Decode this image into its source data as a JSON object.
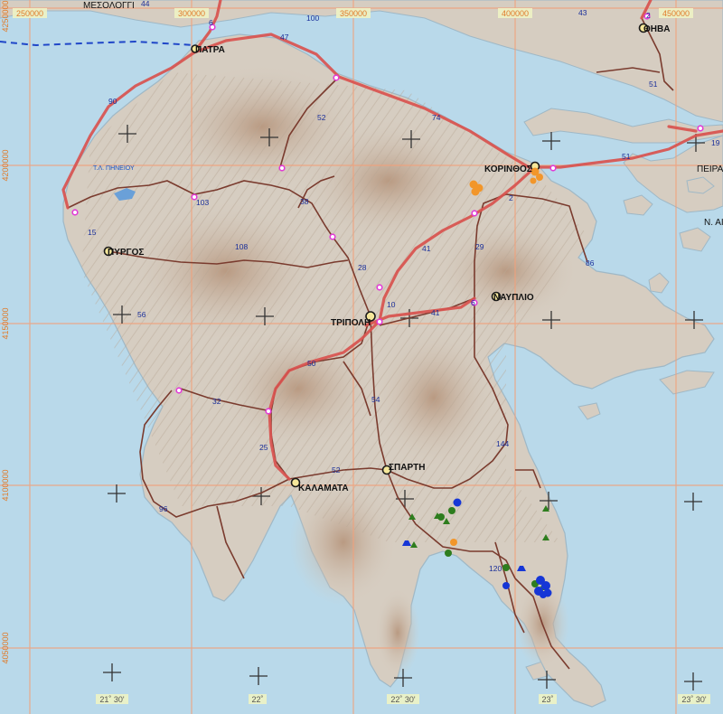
{
  "colors": {
    "sea": "#b9d9ea",
    "land": "#d6cdc1",
    "relief": "#c9b7a4",
    "grid": "#f2a07a",
    "main_road": "#d9534f",
    "local_road": "#7a3b2e",
    "coord_text": "#e07b2a",
    "route_number": "#1a2f9a",
    "city_fill": "#f5e79a",
    "ferry_line": "#1f46c8",
    "lake": "#6aa0d8",
    "marker_green": "#2e7d1e",
    "marker_blue": "#1636d6",
    "marker_orange": "#f2962a",
    "junction": "#e23bd6"
  },
  "top_axis": [
    "250000",
    "300000",
    "350000",
    "400000",
    "450000"
  ],
  "left_axis": [
    "4250000",
    "4200000",
    "4150000",
    "4100000",
    "4050000"
  ],
  "bottom_axis": [
    "21˚ 30'",
    "22˚",
    "22˚ 30'",
    "23˚",
    "23˚ 30'"
  ],
  "cities": [
    "ΠΑΤΡΑ",
    "ΚΟΡΙΝΘΟΣ",
    "ΠΥΡΓΟΣ",
    "ΤΡΙΠΟΛΗ",
    "ΝΑΥΠΛΙΟ",
    "ΣΠΑΡΤΗ",
    "ΚΑΛΑΜΑΤΑ",
    "ΘΗΒΑ"
  ],
  "other_places": [
    "ΜΕΣΟΛΟΓΓΙ",
    "ΠΕΙΡΑ",
    "Ν. ΑΙ"
  ],
  "lake_name": "Τ.Λ. ΠΗΝΕΙΟΥ",
  "route_numbers": [
    "44",
    "100",
    "43",
    "6",
    "47",
    "2",
    "51",
    "90",
    "52",
    "74",
    "19",
    "51",
    "2",
    "103",
    "38",
    "15",
    "108",
    "41",
    "28",
    "29",
    "86",
    "10",
    "6",
    "41",
    "56",
    "50",
    "32",
    "54",
    "25",
    "144",
    "52",
    "96",
    "120"
  ]
}
